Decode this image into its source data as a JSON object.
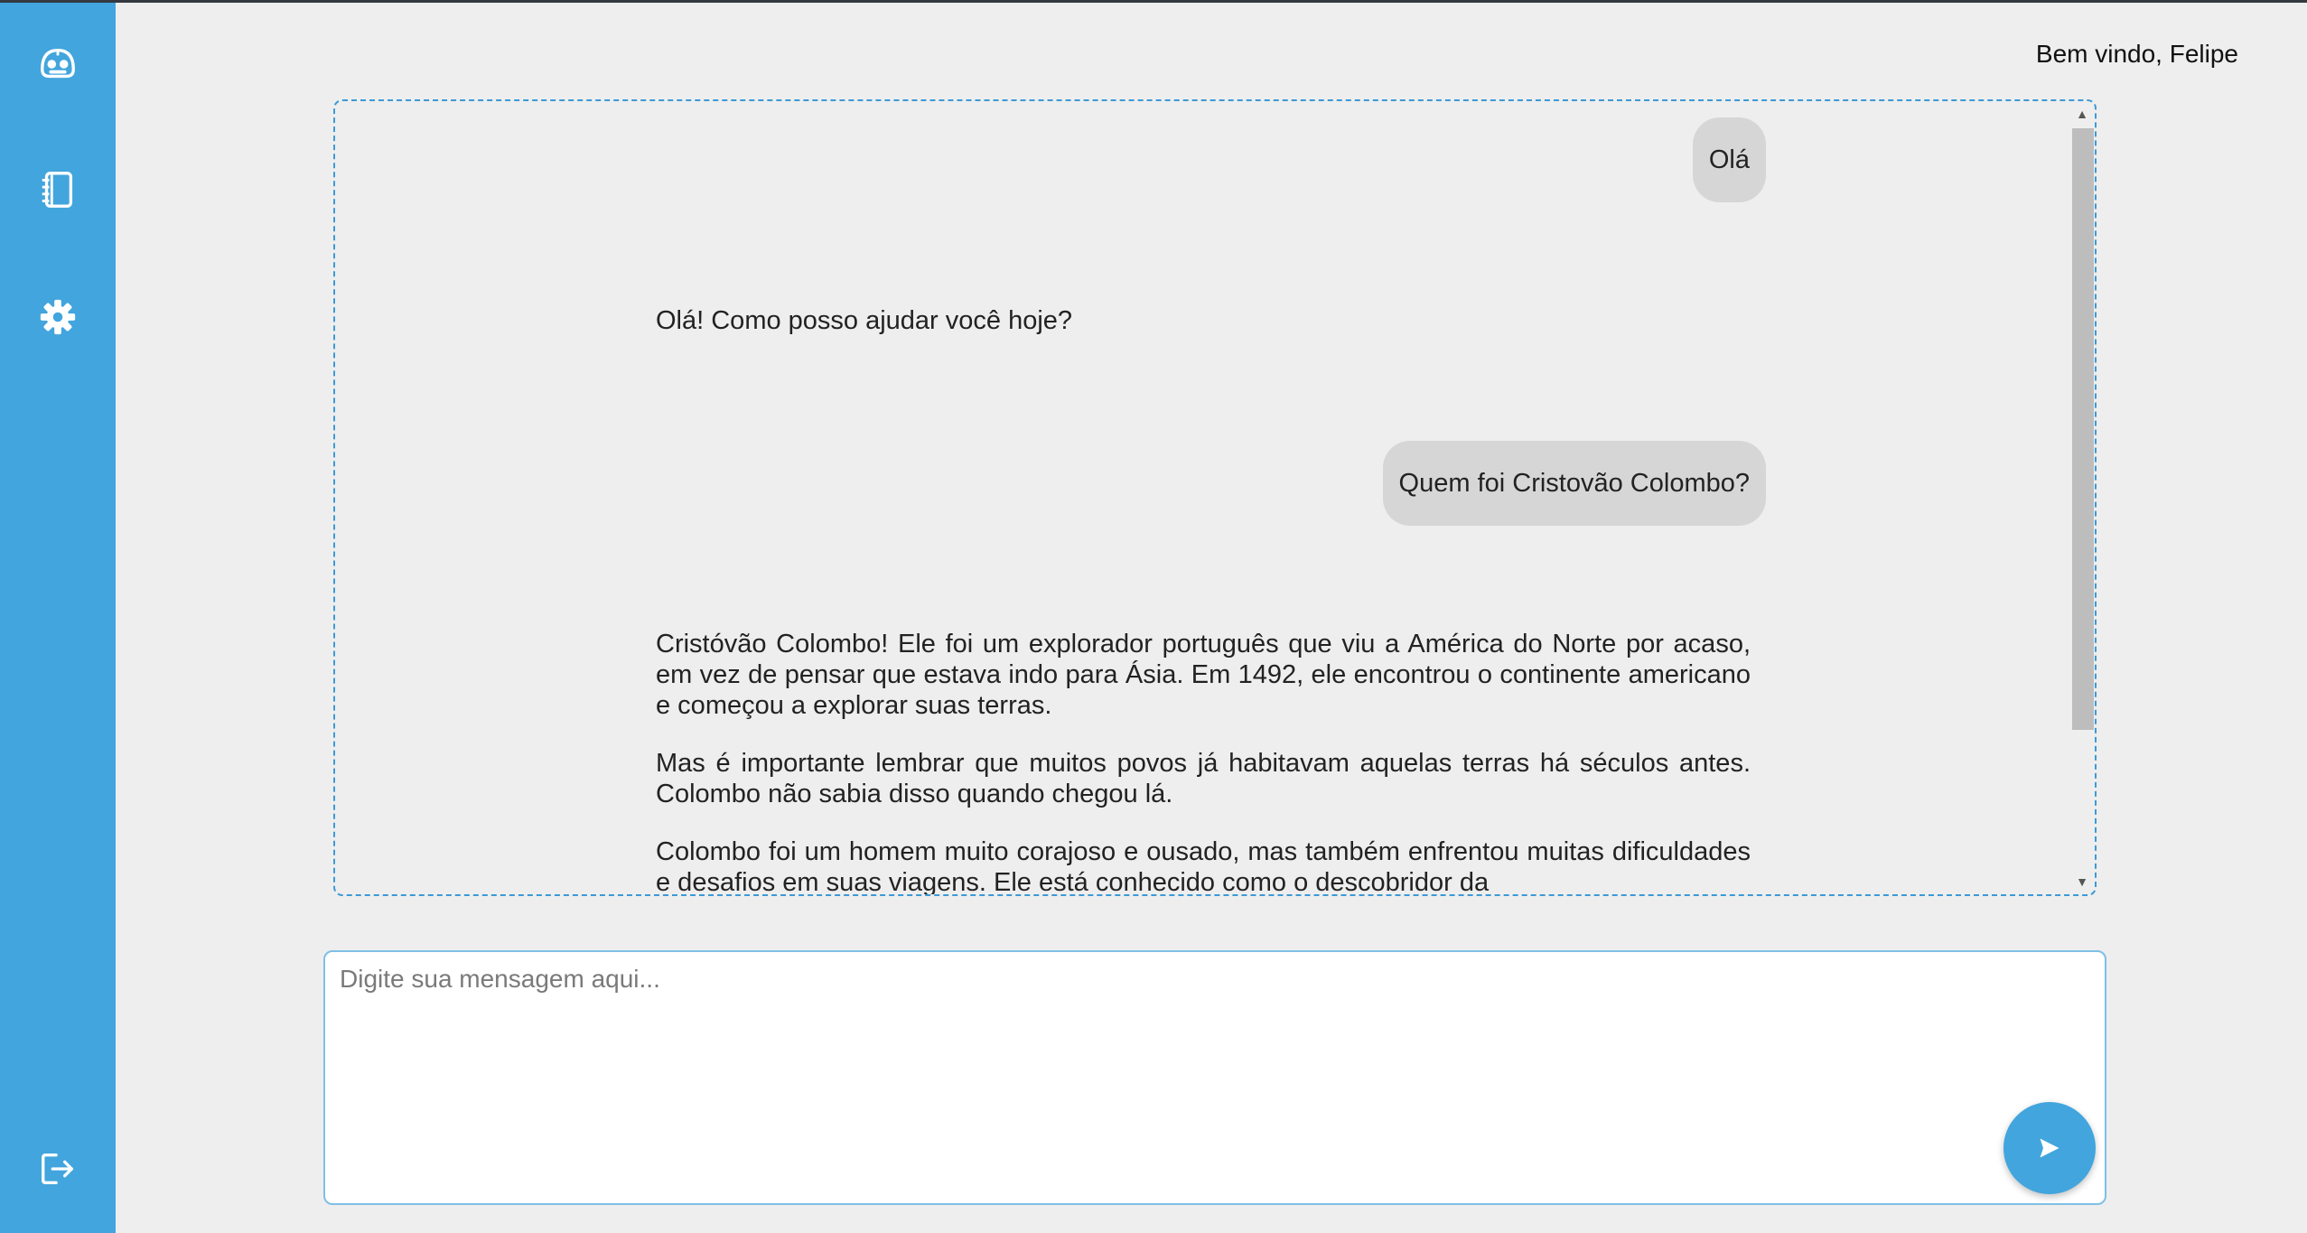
{
  "header": {
    "welcome_text": "Bem vindo, Felipe"
  },
  "sidebar": {
    "items": [
      {
        "name": "assistant-logo",
        "icon": "robot-face-icon"
      },
      {
        "name": "notebook",
        "icon": "notebook-icon"
      },
      {
        "name": "settings",
        "icon": "gear-icon"
      },
      {
        "name": "logout",
        "icon": "logout-icon"
      }
    ]
  },
  "chat": {
    "messages": [
      {
        "role": "user",
        "text": "Olá"
      },
      {
        "role": "assistant",
        "paragraphs": [
          "Olá! Como posso ajudar você hoje?"
        ]
      },
      {
        "role": "user",
        "text": "Quem foi Cristovão Colombo?"
      },
      {
        "role": "assistant",
        "paragraphs": [
          "Cristóvão Colombo! Ele foi um explorador português que viu a América do Norte por acaso, em vez de pensar que estava indo para Ásia. Em 1492, ele encontrou o continente americano e começou a explorar suas terras.",
          "Mas é importante lembrar que muitos povos já habitavam aquelas terras há séculos antes. Colombo não sabia disso quando chegou lá.",
          "Colombo foi um homem muito corajoso e ousado, mas também enfrentou muitas dificuldades e desafios em suas viagens. Ele está conhecido como o descobridor da"
        ]
      }
    ]
  },
  "composer": {
    "placeholder": "Digite sua mensagem aqui...",
    "value": ""
  },
  "colors": {
    "sidebar": "#42a5dd",
    "accent": "#42a5dd",
    "user_bubble": "#d6d6d6",
    "background": "#eeeeee"
  }
}
